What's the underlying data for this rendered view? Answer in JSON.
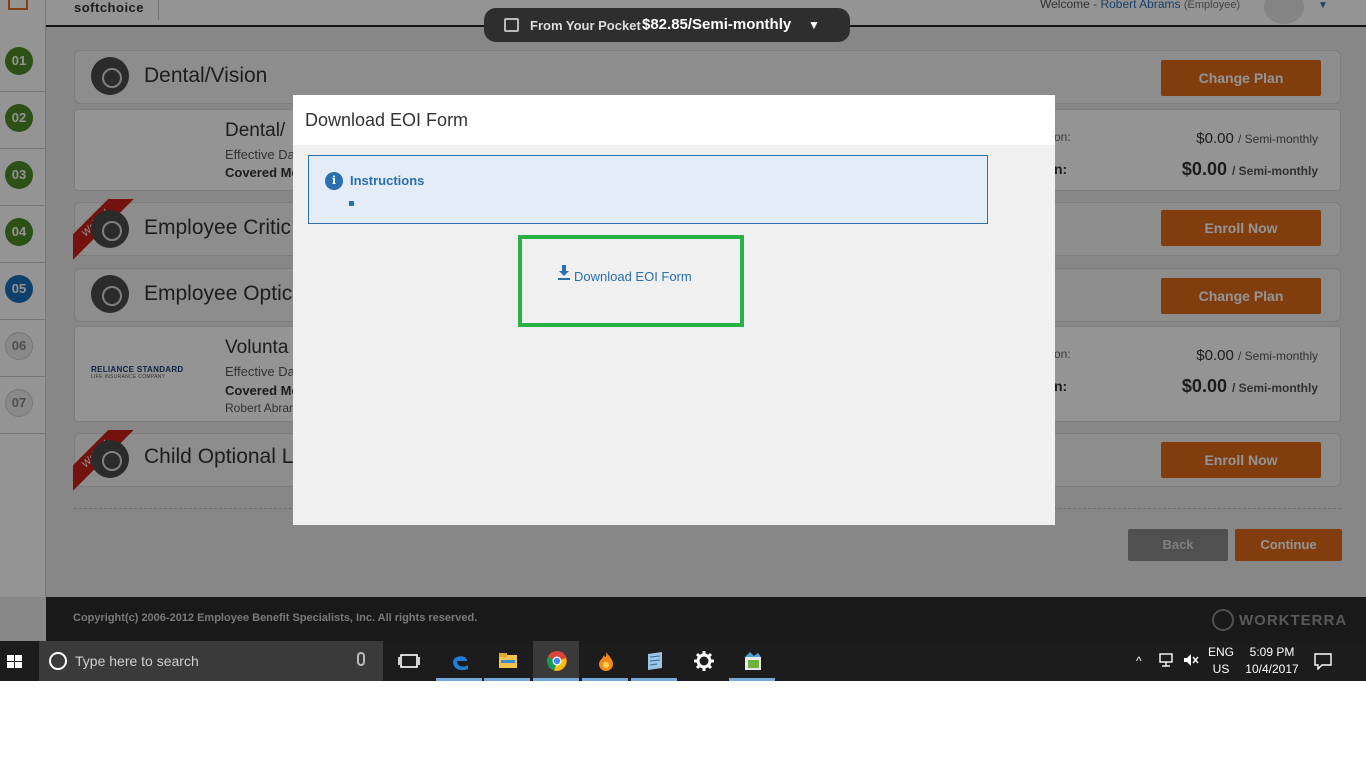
{
  "header": {
    "brand": "softchoice",
    "welcome_prefix": "Welcome -",
    "user_name": "Robert Abrams",
    "user_role": "(Employee)"
  },
  "pocket": {
    "label": "From Your Pocket :",
    "value": "$82.85/Semi-monthly"
  },
  "steps": [
    "01",
    "02",
    "03",
    "04",
    "05",
    "06",
    "07"
  ],
  "cards": {
    "dental": {
      "title": "Dental/Vision",
      "button": "Change Plan"
    },
    "dental_detail": {
      "plan_name": "Dental/",
      "effective": "Effective Da",
      "covered": "Covered Me",
      "cost_label_1": "on:",
      "cost_value_1": "$0.00",
      "cost_label_2": "n:",
      "cost_value_2": "$0.00",
      "per": "/ Semi-monthly"
    },
    "critical": {
      "title": "Employee Critic",
      "button": "Enroll Now",
      "ribbon": "Waived"
    },
    "optional": {
      "title": "Employee Optic",
      "button": "Change Plan"
    },
    "optional_detail": {
      "logo_name": "RELIANCE STANDARD",
      "logo_sub": "LIFE INSURANCE COMPANY",
      "plan_name": "Volunta",
      "effective": "Effective Da",
      "covered": "Covered Me",
      "member": "Robert Abrar",
      "cost_label_1": "on:",
      "cost_value_1": "$0.00",
      "cost_label_2": "n:",
      "cost_value_2": "$0.00",
      "per": "/ Semi-monthly"
    },
    "child": {
      "title": "Child Optional L",
      "button": "Enroll Now",
      "ribbon": "Waived"
    }
  },
  "nav": {
    "back": "Back",
    "continue": "Continue"
  },
  "footer": {
    "copyright": "Copyright(c) 2006-2012 Employee Benefit Specialists, Inc. All rights reserved.",
    "brand": "WORKTERRA"
  },
  "modal": {
    "title": "Download EOI Form",
    "instructions_label": "Instructions",
    "download_link": "Download EOI Form"
  },
  "taskbar": {
    "search_placeholder": "Type here to search",
    "lang_top": "ENG",
    "lang_bottom": "US",
    "time": "5:09 PM",
    "date": "10/4/2017"
  }
}
